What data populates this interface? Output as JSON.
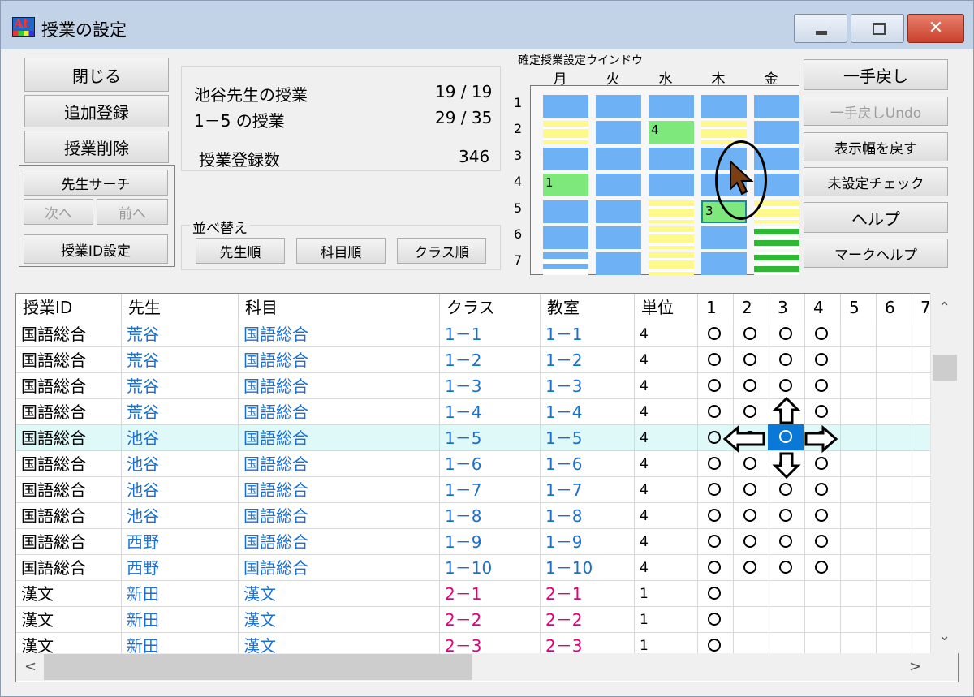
{
  "window": {
    "title": "授業の設定"
  },
  "left_buttons": {
    "close": "閉じる",
    "add": "追加登録",
    "delete": "授業削除",
    "teacher_search": "先生サーチ",
    "next": "次へ",
    "prev": "前へ",
    "lesson_id_set": "授業ID設定"
  },
  "info": {
    "teacher_label": "池谷先生の授業",
    "teacher_count": "19 / 19",
    "class_label": "1－5 の授業",
    "class_count": "29 / 35",
    "total_label": "授業登録数",
    "total_count": "346"
  },
  "sort": {
    "label": "並べ替え",
    "by_teacher": "先生順",
    "by_subject": "科目順",
    "by_class": "クラス順"
  },
  "confirm_window": {
    "label": "確定授業設定ウインドウ",
    "days": [
      "月",
      "火",
      "水",
      "木",
      "金"
    ],
    "periods": [
      "1",
      "2",
      "3",
      "4",
      "5",
      "6",
      "7"
    ],
    "markers": {
      "mon_p4": "1",
      "wed_p2": "4",
      "thu_p5": "3"
    },
    "colors": {
      "blue": "#6eb1f4",
      "green": "#7fe87d",
      "yellow": "#fff98c",
      "dark_green": "#2fb834"
    }
  },
  "right_buttons": {
    "undo": "一手戻し",
    "undo_undo": "一手戻しUndo",
    "reset_width": "表示幅を戻す",
    "unset_check": "未設定チェック",
    "help": "ヘルプ",
    "mark_help": "マークヘルプ"
  },
  "table": {
    "headers": [
      "授業ID",
      "先生",
      "科目",
      "クラス",
      "教室",
      "単位",
      "1",
      "2",
      "3",
      "4",
      "5",
      "6",
      "7"
    ],
    "rows": [
      {
        "id": "国語総合",
        "teacher": "荒谷",
        "subject": "国語総合",
        "class": "1－1",
        "room": "1－1",
        "units": "4"
      },
      {
        "id": "国語総合",
        "teacher": "荒谷",
        "subject": "国語総合",
        "class": "1－2",
        "room": "1－2",
        "units": "4"
      },
      {
        "id": "国語総合",
        "teacher": "荒谷",
        "subject": "国語総合",
        "class": "1－3",
        "room": "1－3",
        "units": "4"
      },
      {
        "id": "国語総合",
        "teacher": "荒谷",
        "subject": "国語総合",
        "class": "1－4",
        "room": "1－4",
        "units": "4"
      },
      {
        "id": "国語総合",
        "teacher": "池谷",
        "subject": "国語総合",
        "class": "1－5",
        "room": "1－5",
        "units": "4"
      },
      {
        "id": "国語総合",
        "teacher": "池谷",
        "subject": "国語総合",
        "class": "1－6",
        "room": "1－6",
        "units": "4"
      },
      {
        "id": "国語総合",
        "teacher": "池谷",
        "subject": "国語総合",
        "class": "1－7",
        "room": "1－7",
        "units": "4"
      },
      {
        "id": "国語総合",
        "teacher": "池谷",
        "subject": "国語総合",
        "class": "1－8",
        "room": "1－8",
        "units": "4"
      },
      {
        "id": "国語総合",
        "teacher": "西野",
        "subject": "国語総合",
        "class": "1－9",
        "room": "1－9",
        "units": "4"
      },
      {
        "id": "国語総合",
        "teacher": "西野",
        "subject": "国語総合",
        "class": "1－10",
        "room": "1－10",
        "units": "4"
      },
      {
        "id": "漢文",
        "teacher": "新田",
        "subject": "漢文",
        "class": "2－1",
        "room": "2－1",
        "units": "1"
      },
      {
        "id": "漢文",
        "teacher": "新田",
        "subject": "漢文",
        "class": "2－2",
        "room": "2－2",
        "units": "1"
      },
      {
        "id": "漢文",
        "teacher": "新田",
        "subject": "漢文",
        "class": "2－3",
        "room": "2－3",
        "units": "1"
      }
    ],
    "selected_row": 4,
    "scroll": {
      "up": "⌃",
      "down": "⌄",
      "left": "<",
      "right": ">"
    }
  }
}
